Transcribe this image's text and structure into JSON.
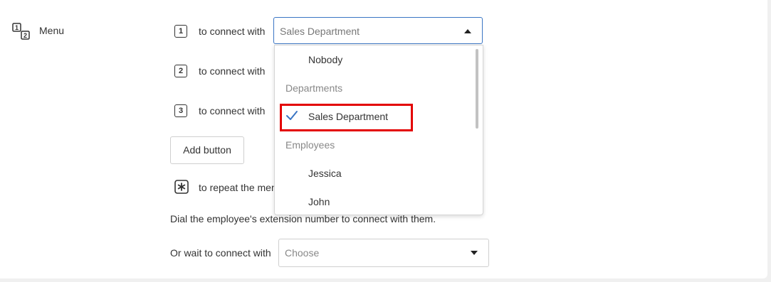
{
  "menu": {
    "label": "Menu",
    "icon": "numbered-menu-icon"
  },
  "rows": [
    {
      "key": "1",
      "text": "to connect with"
    },
    {
      "key": "2",
      "text": "to connect with"
    },
    {
      "key": "3",
      "text": "to connect with"
    }
  ],
  "top_select": {
    "value": "Sales Department"
  },
  "dropdown": {
    "option_nobody": "Nobody",
    "header_departments": "Departments",
    "option_sales": "Sales Department",
    "header_employees": "Employees",
    "option_jessica": "Jessica",
    "option_john": "John"
  },
  "add_button": "Add button",
  "repeat": {
    "key_icon": "asterisk-icon",
    "text": "to repeat the menu"
  },
  "hint": "Dial the employee's extension number to connect with them.",
  "wait": {
    "label": "Or wait to connect with",
    "placeholder": "Choose"
  },
  "colors": {
    "accent": "#3a75c4",
    "highlight": "#e30000"
  }
}
